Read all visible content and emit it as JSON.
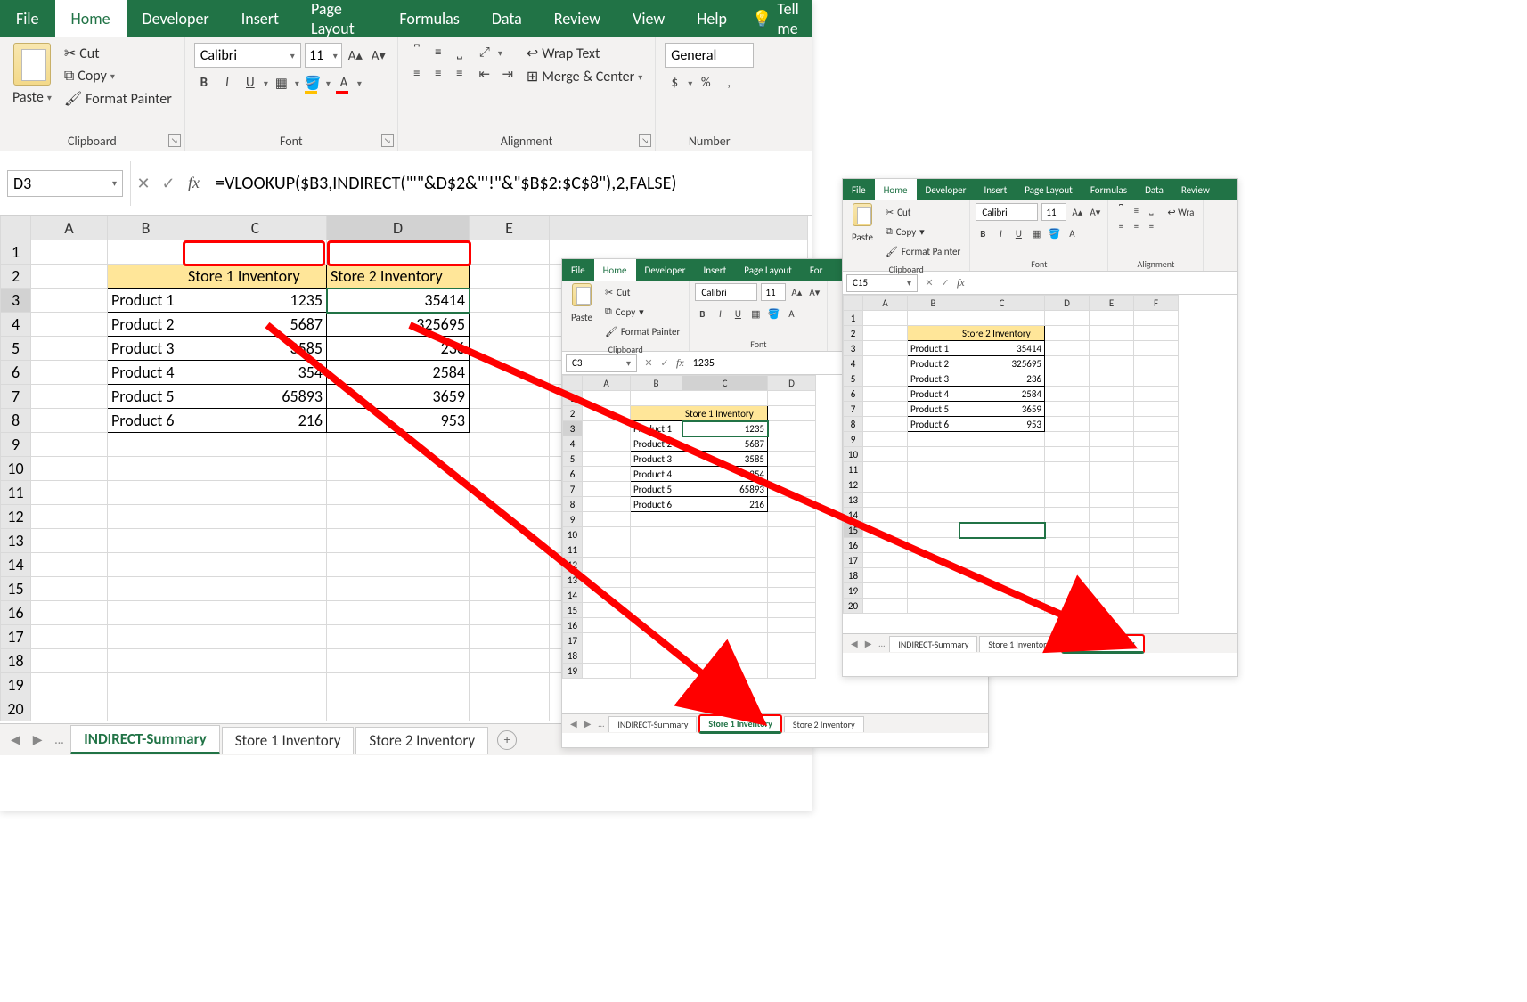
{
  "tabs": [
    "File",
    "Home",
    "Developer",
    "Insert",
    "Page Layout",
    "Formulas",
    "Data",
    "Review",
    "View",
    "Help"
  ],
  "tellme": "Tell me",
  "clipboard": {
    "label": "Clipboard",
    "paste": "Paste",
    "cut": "Cut",
    "copy": "Copy",
    "fmtpainter": "Format Painter"
  },
  "font": {
    "label": "Font",
    "name": "Calibri",
    "size": "11",
    "bold": "B",
    "italic": "I",
    "underline": "U"
  },
  "alignment": {
    "label": "Alignment",
    "wrap": "Wrap Text",
    "merge": "Merge & Center"
  },
  "number": {
    "label": "Number",
    "fmt": "General",
    "dollar": "$",
    "pct": "%",
    "comma": ","
  },
  "main": {
    "cellref": "D3",
    "formula": "=VLOOKUP($B3,INDIRECT(\"'\"&D$2&\"'!\"&\"$B$2:$C$8\"),2,FALSE)",
    "cols": [
      "A",
      "B",
      "C",
      "D",
      "E"
    ],
    "header": {
      "c": "Store 1 Inventory",
      "d": "Store 2 Inventory"
    },
    "rows": [
      {
        "b": "Product 1",
        "c": "1235",
        "d": "35414"
      },
      {
        "b": "Product 2",
        "c": "5687",
        "d": "325695"
      },
      {
        "b": "Product 3",
        "c": "3585",
        "d": "236"
      },
      {
        "b": "Product 4",
        "c": "354",
        "d": "2584"
      },
      {
        "b": "Product 5",
        "c": "65893",
        "d": "3659"
      },
      {
        "b": "Product 6",
        "c": "216",
        "d": "953"
      }
    ],
    "sheets": [
      "INDIRECT-Summary",
      "Store 1 Inventory",
      "Store 2 Inventory"
    ]
  },
  "s1": {
    "cellref": "C3",
    "formula": "1235",
    "cols": [
      "A",
      "B",
      "C",
      "D"
    ],
    "header": "Store 1 Inventory",
    "rows": [
      {
        "b": "Product 1",
        "c": "1235"
      },
      {
        "b": "Product 2",
        "c": "5687"
      },
      {
        "b": "Product 3",
        "c": "3585"
      },
      {
        "b": "Product 4",
        "c": "354"
      },
      {
        "b": "Product 5",
        "c": "65893"
      },
      {
        "b": "Product 6",
        "c": "216"
      }
    ],
    "sheets": [
      "INDIRECT-Summary",
      "Store 1 Inventory",
      "Store 2 Inventory"
    ]
  },
  "s2": {
    "cellref": "C15",
    "formula": "",
    "cols": [
      "A",
      "B",
      "C",
      "D",
      "E",
      "F"
    ],
    "header": "Store 2 Inventory",
    "rows": [
      {
        "b": "Product 1",
        "c": "35414"
      },
      {
        "b": "Product 2",
        "c": "325695"
      },
      {
        "b": "Product 3",
        "c": "236"
      },
      {
        "b": "Product 4",
        "c": "2584"
      },
      {
        "b": "Product 5",
        "c": "3659"
      },
      {
        "b": "Product 6",
        "c": "953"
      }
    ],
    "sheets": [
      "INDIRECT-Summary",
      "Store 1 Inventory",
      "Store 2 Inventory"
    ]
  }
}
